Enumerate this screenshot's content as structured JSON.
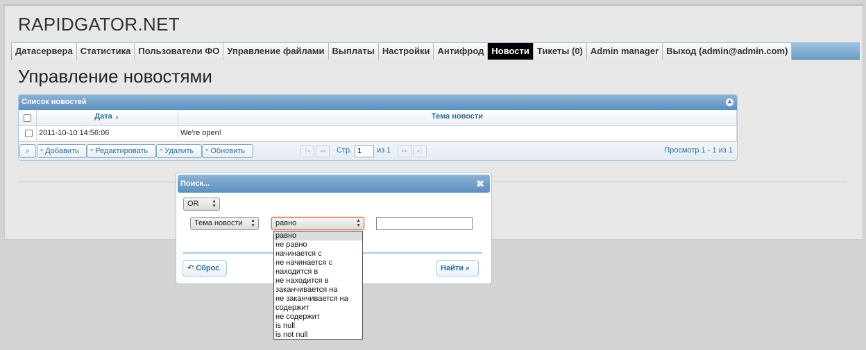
{
  "site": {
    "title": "RAPIDGATOR.NET"
  },
  "nav": {
    "items": [
      {
        "label": "Датасервера"
      },
      {
        "label": "Статистика"
      },
      {
        "label": "Пользователи ФО"
      },
      {
        "label": "Управление файлами"
      },
      {
        "label": "Выплаты"
      },
      {
        "label": "Настройки"
      },
      {
        "label": "Антифрод"
      },
      {
        "label": "Новости",
        "active": true
      },
      {
        "label": "Тикеты (0)"
      },
      {
        "label": "Admin manager"
      },
      {
        "label": "Выход (admin@admin.com)"
      }
    ]
  },
  "page": {
    "title": "Управление новостями"
  },
  "grid": {
    "caption": "Список новостей",
    "columns": {
      "date": "Дата",
      "topic": "Тема новости"
    },
    "rows": [
      {
        "date": "2011-10-10 14:56:06",
        "topic": "We're open!"
      }
    ],
    "pager": {
      "add": "Добавить",
      "edit": "Редактировать",
      "delete": "Удалить",
      "refresh": "Обновить",
      "page_label": "Стр.",
      "page_value": "1",
      "of_label": "из 1",
      "view_text": "Просмотр 1 - 1 из 1"
    }
  },
  "search_dialog": {
    "title": "Поиск...",
    "group_op": "OR",
    "field": "Тема новости",
    "operator": "равно",
    "value": "",
    "reset": "Сброс",
    "find": "Найти"
  },
  "operator_options": [
    "равно",
    "не равно",
    "начинается с",
    "не начинается с",
    "находится в",
    "не находится в",
    "заканчивается на",
    "не заканчивается на",
    "содержит",
    "не содержит",
    "is null",
    "is not null"
  ],
  "colors": {
    "accent": "#5d8fbf",
    "active_tab": "#000000",
    "focus": "#e06a3c"
  }
}
